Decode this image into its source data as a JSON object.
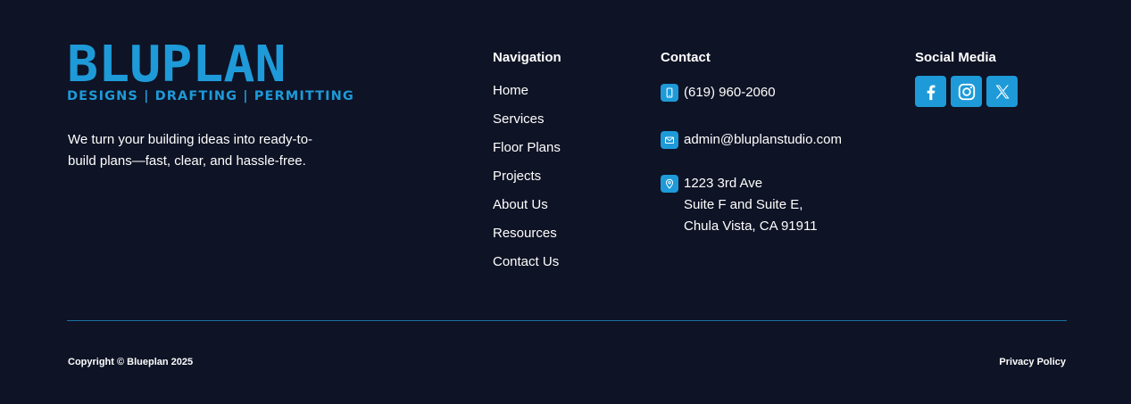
{
  "brand": {
    "logo_text": "BLUPLAN",
    "tagline": "DESIGNS | DRAFTING | PERMITTING",
    "description": "We turn your building ideas into ready-to-build plans—fast, clear, and hassle-free."
  },
  "navigation": {
    "heading": "Navigation",
    "items": [
      {
        "label": "Home"
      },
      {
        "label": "Services"
      },
      {
        "label": "Floor Plans"
      },
      {
        "label": "Projects"
      },
      {
        "label": "About Us"
      },
      {
        "label": "Resources"
      },
      {
        "label": "Contact Us"
      }
    ]
  },
  "contact": {
    "heading": "Contact",
    "phone": "(619) 960-2060",
    "email": "admin@bluplanstudio.com",
    "address": {
      "line1": "1223 3rd Ave",
      "line2": "Suite F and Suite E,",
      "line3": "Chula Vista, CA 91911"
    }
  },
  "social": {
    "heading": "Social Media",
    "icons": [
      "facebook-icon",
      "instagram-icon",
      "x-icon"
    ]
  },
  "bottom": {
    "copyright": "Copyright © Blueplan 2025",
    "privacy": "Privacy Policy"
  },
  "colors": {
    "background": "#0e1325",
    "accent": "#1e9ad8",
    "divider": "#1a6f9f",
    "text": "#ffffff"
  }
}
